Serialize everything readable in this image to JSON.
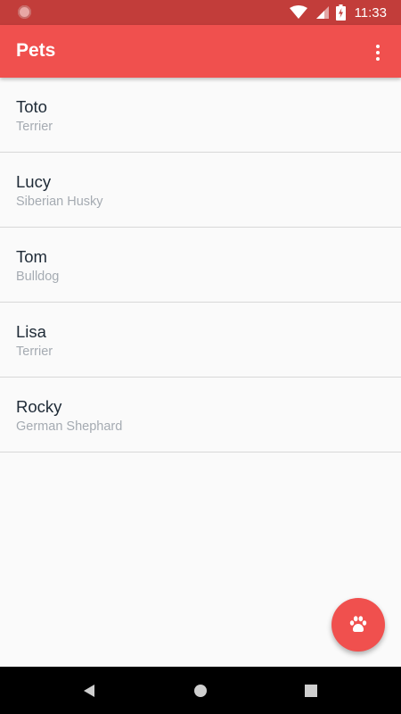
{
  "status_bar": {
    "time": "11:33",
    "icons": [
      "notification-icon",
      "wifi-icon",
      "signal-icon",
      "battery-icon"
    ]
  },
  "app_bar": {
    "title": "Pets",
    "menu_icon": "more-vert-icon",
    "background": "#f0504e"
  },
  "pets": [
    {
      "name": "Toto",
      "breed": "Terrier"
    },
    {
      "name": "Lucy",
      "breed": "Siberian Husky"
    },
    {
      "name": "Tom",
      "breed": "Bulldog"
    },
    {
      "name": "Lisa",
      "breed": "Terrier"
    },
    {
      "name": "Rocky",
      "breed": "German Shephard"
    }
  ],
  "fab": {
    "icon": "paw-icon",
    "color": "#f0504e"
  },
  "nav_bar": {
    "buttons": [
      "back-icon",
      "home-icon",
      "recents-icon"
    ]
  },
  "colors": {
    "status_bar": "#c23d3a",
    "primary": "#f0504e",
    "name_text": "#1e2a36",
    "breed_text": "#a5abb2",
    "divider": "#d8d8d8"
  }
}
